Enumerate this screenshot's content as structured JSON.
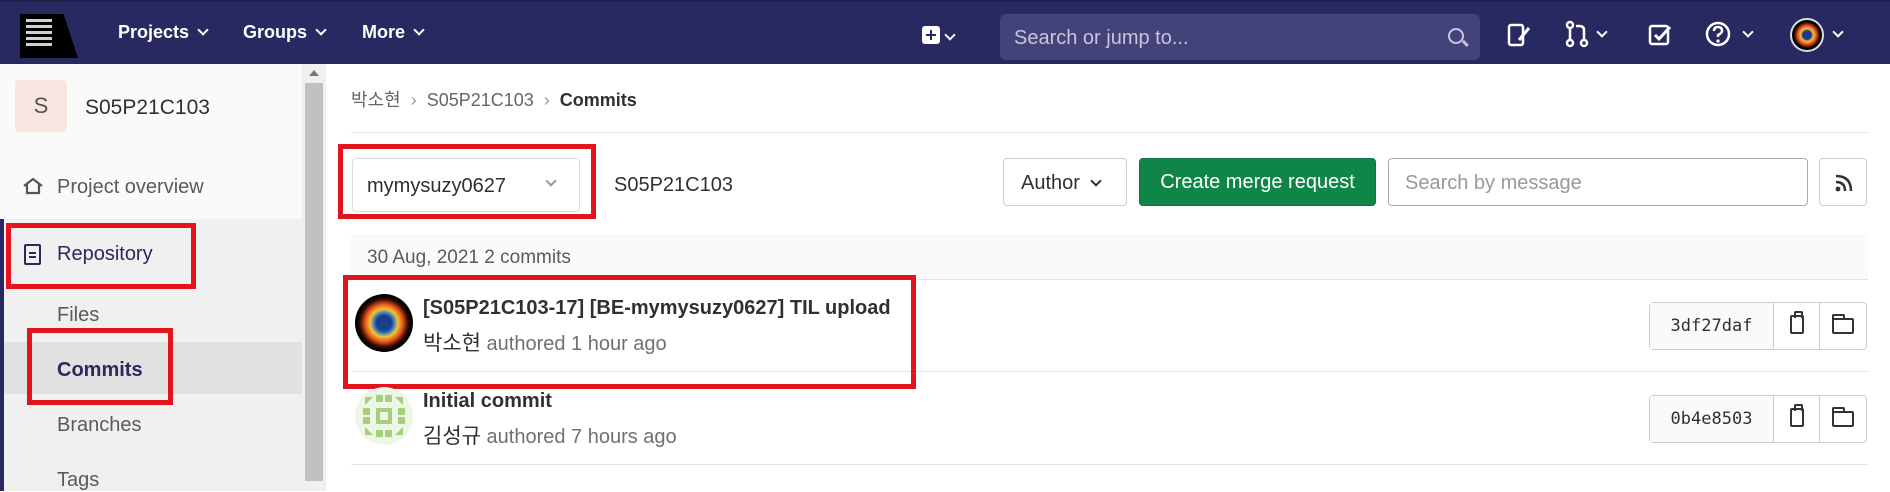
{
  "navbar": {
    "projects": "Projects",
    "groups": "Groups",
    "more": "More",
    "search_placeholder": "Search or jump to..."
  },
  "sidebar": {
    "project_initial": "S",
    "project_name": "S05P21C103",
    "items": [
      {
        "label": "Project overview"
      },
      {
        "label": "Repository"
      },
      {
        "label": "Files"
      },
      {
        "label": "Commits"
      },
      {
        "label": "Branches"
      },
      {
        "label": "Tags"
      }
    ]
  },
  "breadcrumb": {
    "user": "박소현",
    "project": "S05P21C103",
    "current": "Commits"
  },
  "toolbar": {
    "branch": "mymysuzy0627",
    "project_path": "S05P21C103",
    "author_label": "Author",
    "merge_label": "Create merge request",
    "search_placeholder": "Search by message"
  },
  "day_header": "30 Aug, 2021 2 commits",
  "commits": [
    {
      "title": "[S05P21C103-17] [BE-mymysuzy0627] TIL upload",
      "author": "박소현",
      "meta": "authored 1 hour ago",
      "sha": "3df27daf"
    },
    {
      "title": "Initial commit",
      "author": "김성규",
      "meta": "authored 7 hours ago",
      "sha": "0b4e8503"
    }
  ],
  "colors": {
    "navbar": "#292961",
    "accent_green": "#108548",
    "highlight_red": "#e3141e"
  }
}
